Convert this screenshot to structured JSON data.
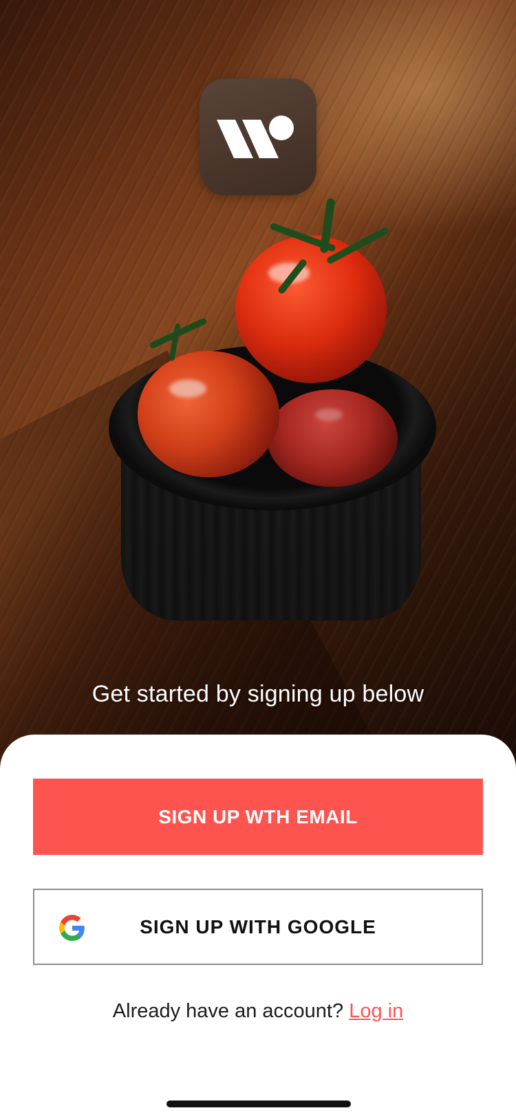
{
  "tagline": "Get started by signing up below",
  "buttons": {
    "email_label": "SIGN UP WTH EMAIL",
    "google_label": "SIGN UP WITH GOOGLE"
  },
  "login": {
    "prompt": "Already have an account?",
    "link_label": "Log in"
  },
  "icons": {
    "logo": "app-logo-icon",
    "google": "google-icon"
  },
  "colors": {
    "accent": "#fd544f",
    "sheet_background": "#ffffff",
    "logo_background": "#4a362b",
    "google_border": "#8d8d8d"
  }
}
